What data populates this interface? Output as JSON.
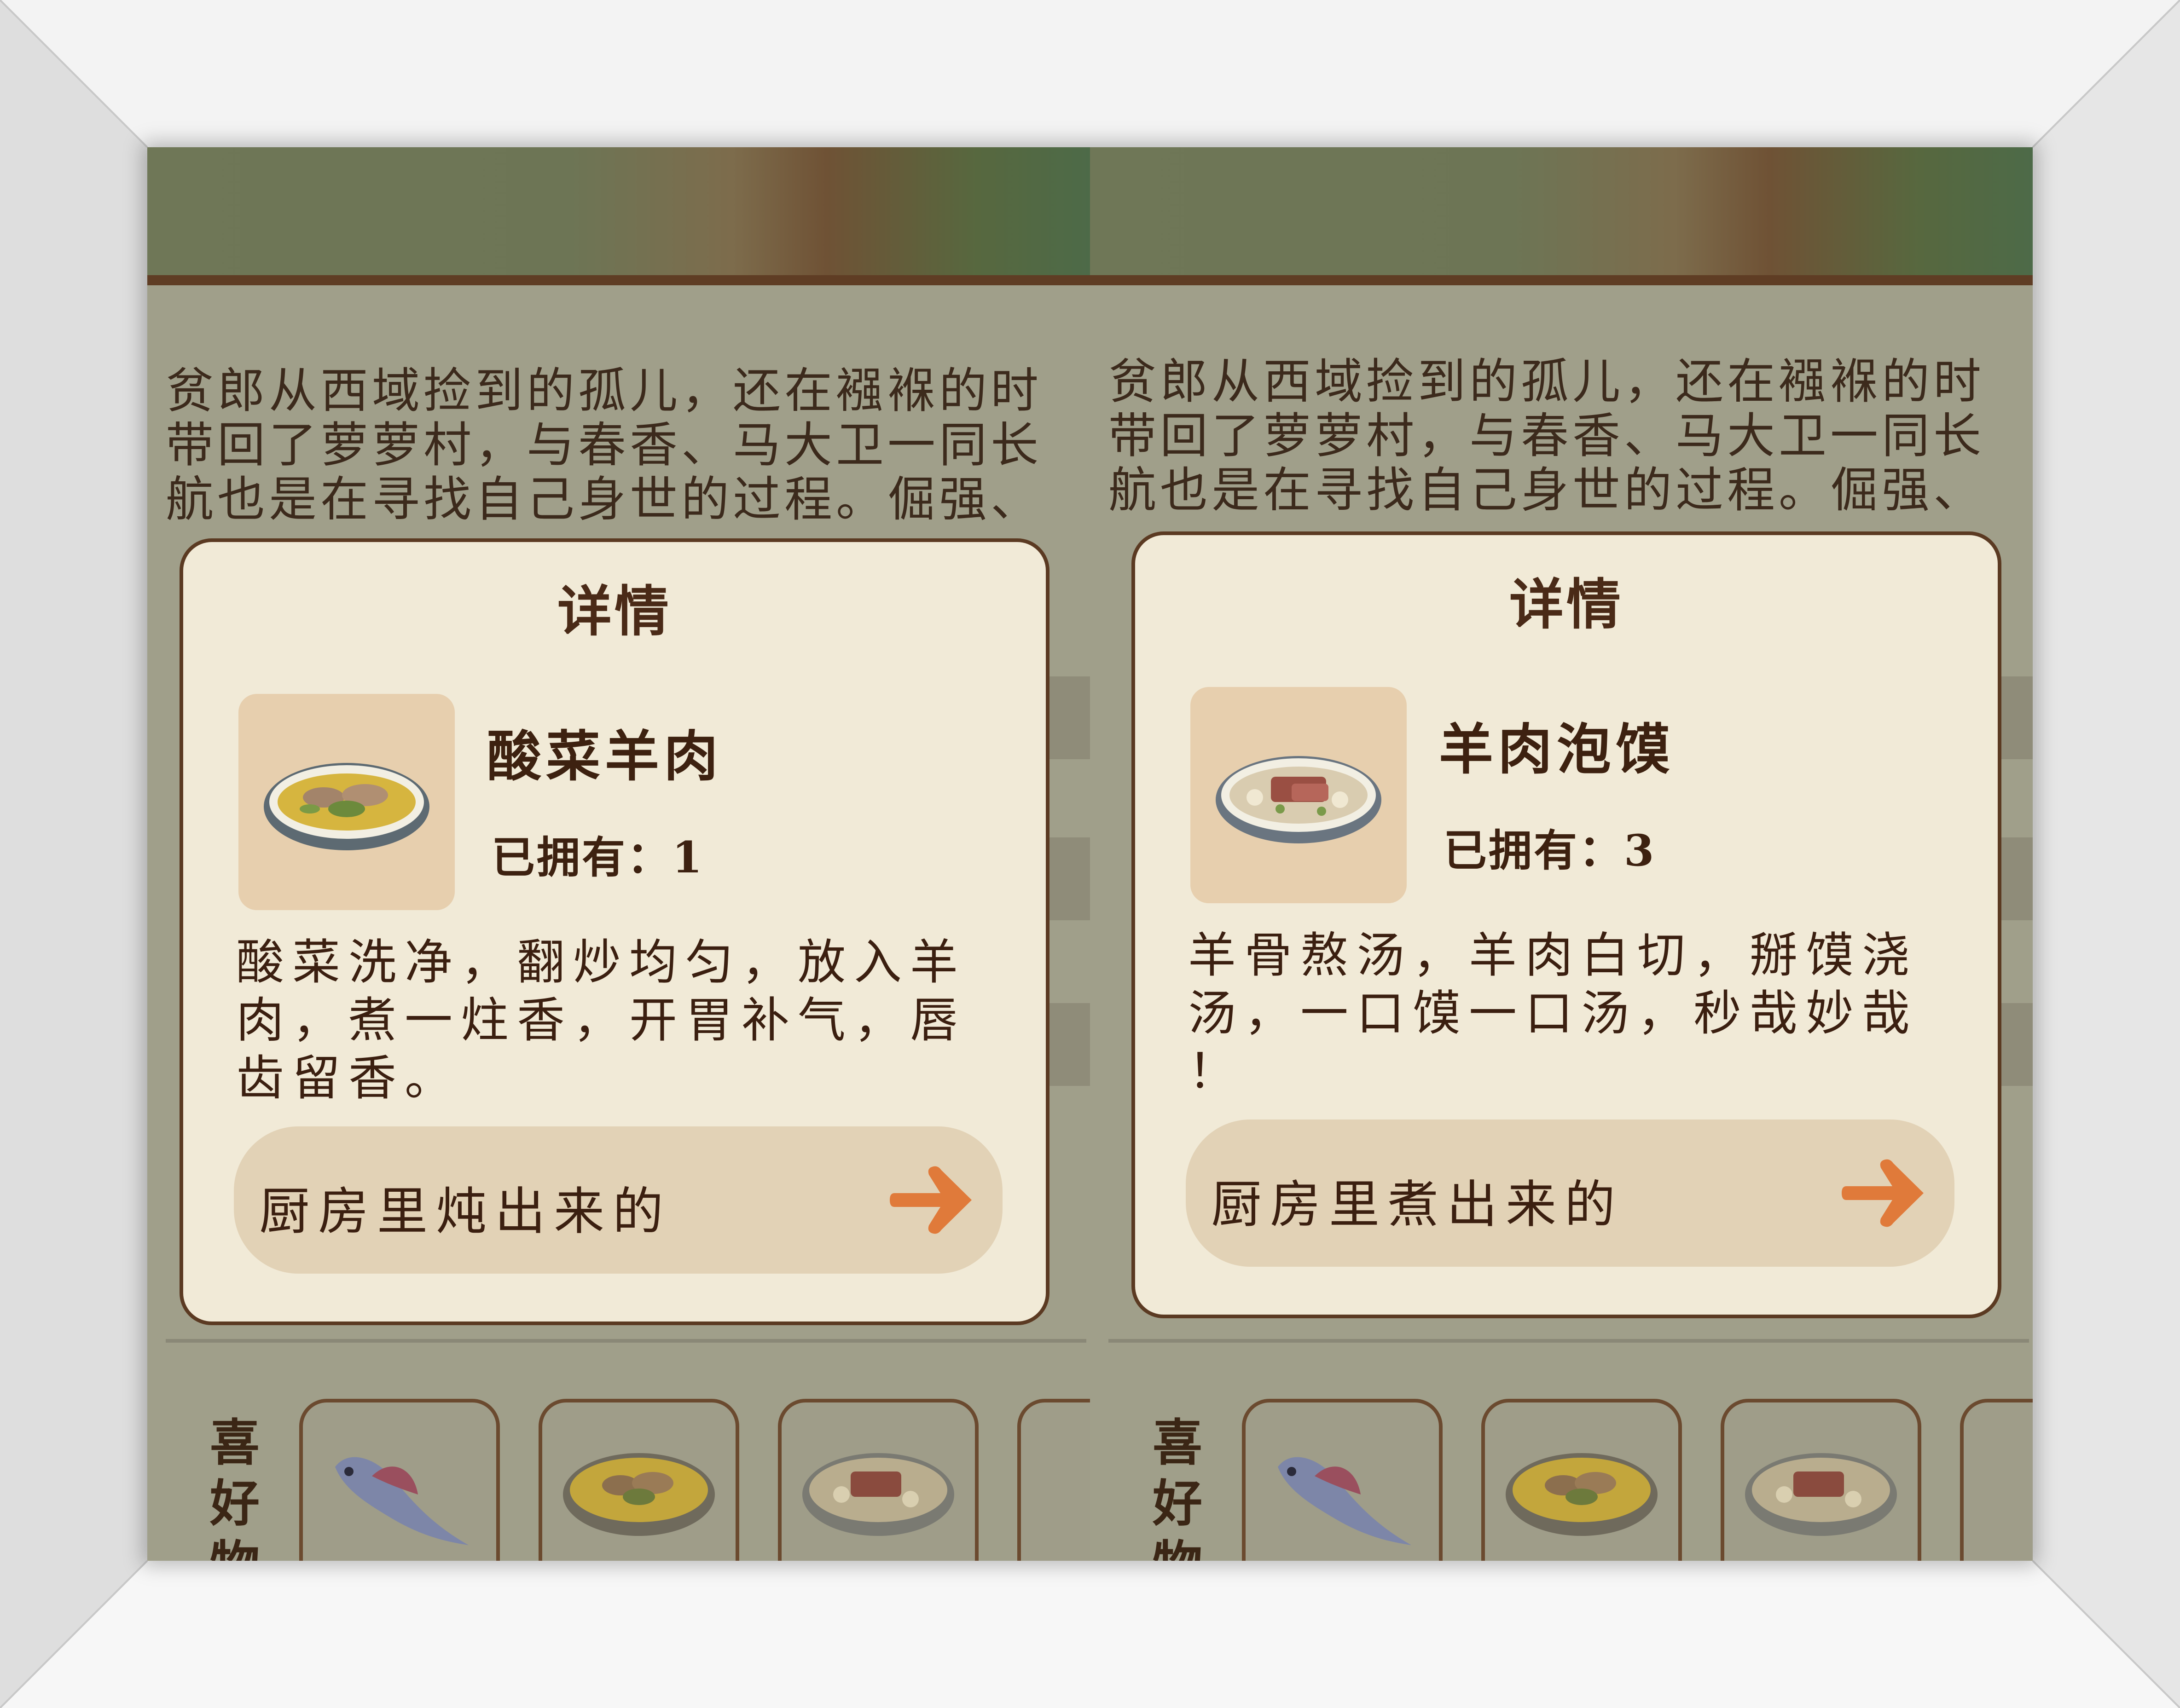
{
  "bio": {
    "lines": [
      "贫郎从西域捡到的孤儿，还在襁褓的时",
      "带回了萝萝村，与春香、马大卫一同长",
      "航也是在寻找自己身世的过程。倔强、"
    ]
  },
  "left_panel": {
    "modal": {
      "title": "详情",
      "food_name": "酸菜羊肉",
      "owned_label": "已拥有：",
      "owned_count": "1",
      "description": "酸菜洗净，翻炒均匀，放入羊\n肉，煮一炷香，开胃补气，唇\n齿留香。",
      "source_label": "厨房里炖出来的",
      "source_icon": "arrow-right-icon"
    },
    "favorites_label": "喜\n好\n物"
  },
  "right_panel": {
    "modal": {
      "title": "详情",
      "food_name": "羊肉泡馍",
      "owned_label": "已拥有：",
      "owned_count": "3",
      "description": "羊骨熬汤，羊肉白切，掰馍浇\n汤，一口馍一口汤，秒哉妙哉\n！",
      "source_label": "厨房里煮出来的",
      "source_icon": "arrow-right-icon"
    },
    "favorites_label": "喜\n好\n物"
  },
  "favorite_items": [
    "fish-icon",
    "sauerkraut-mutton-icon",
    "mutton-paomo-icon"
  ],
  "colors": {
    "modal_bg": "#f1ead7",
    "modal_border": "#5b3a22",
    "text_dark": "#3b1f10",
    "arrow": "#e07a3a",
    "source_button": "#e2d2b6"
  }
}
